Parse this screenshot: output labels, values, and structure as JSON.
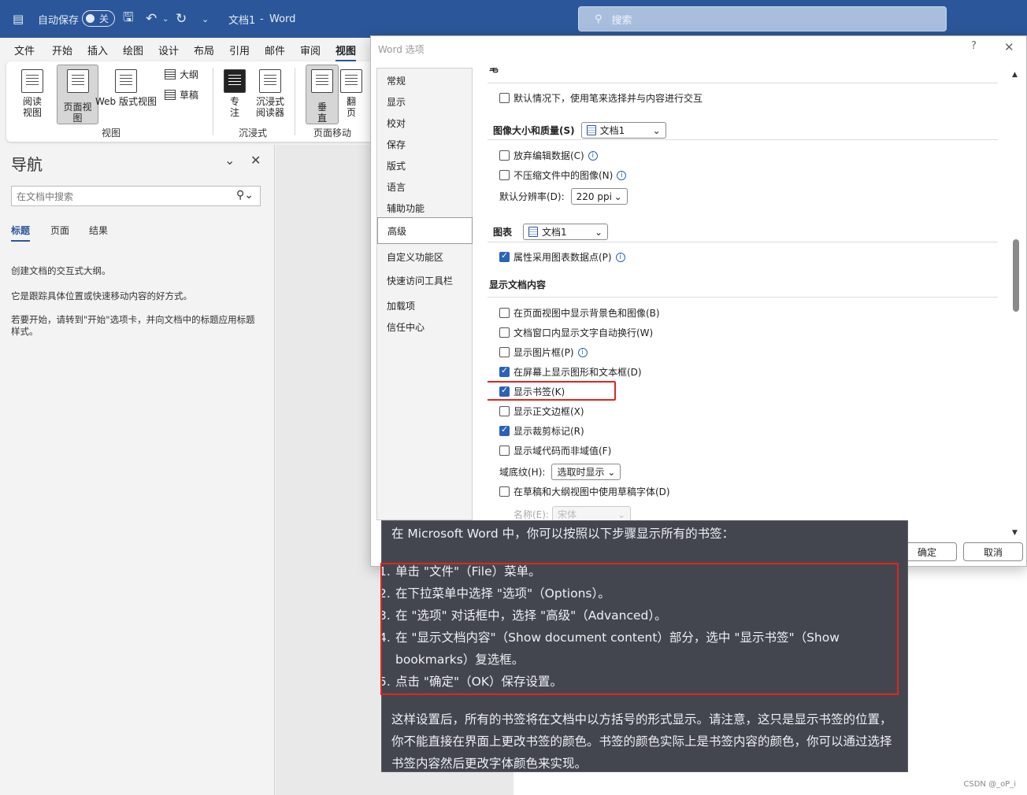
{
  "titlebar": {
    "autosave_label": "自动保存",
    "autosave_state": "关",
    "document_title": "文档1",
    "separator": "-",
    "app_name": "Word",
    "search_placeholder": "搜索"
  },
  "ribbon": {
    "tabs": [
      "文件",
      "开始",
      "插入",
      "绘图",
      "设计",
      "布局",
      "引用",
      "邮件",
      "审阅",
      "视图"
    ],
    "active_tab": "视图",
    "buttons": {
      "read_mode": "阅读视图",
      "print_layout": "页面视图",
      "web_layout": "Web 版式视图",
      "outline": "大纲",
      "draft": "草稿",
      "focus": "专注",
      "immersive_reader": "沉浸式阅读器",
      "vertical": "垂直",
      "side_to_side": "翻页"
    },
    "groups": {
      "views": "视图",
      "immersive": "沉浸式",
      "page_movement": "页面移动"
    }
  },
  "nav": {
    "title": "导航",
    "search_placeholder": "在文档中搜索",
    "tabs": [
      "标题",
      "页面",
      "结果"
    ],
    "active_tab": "标题",
    "text1": "创建文档的交互式大纲。",
    "text2": "它是跟踪具体位置或快速移动内容的好方式。",
    "text3": "若要开始，请转到\"开始\"选项卡，并向文档中的标题应用标题样式。"
  },
  "dialog": {
    "title": "Word 选项",
    "help": "?",
    "close": "✕",
    "categories": [
      "常规",
      "显示",
      "校对",
      "保存",
      "版式",
      "语言",
      "辅助功能",
      "高级",
      "自定义功能区",
      "快速访问工具栏",
      "加载项",
      "信任中心"
    ],
    "active_category": "高级",
    "pen_section_partial": "笔",
    "pen_option": "默认情况下，使用笔来选择并与内容进行交互",
    "image_section": "图像大小和质量(S)",
    "image_doc": "文档1",
    "image_options": [
      "放弃编辑数据(C)",
      "不压缩文件中的图像(N)"
    ],
    "resolution_label": "默认分辨率(D):",
    "resolution_value": "220 ppi",
    "chart_section": "图表",
    "chart_doc": "文档1",
    "chart_option": "属性采用图表数据点(P)",
    "show_section": "显示文档内容",
    "show_options": [
      {
        "label": "在页面视图中显示背景色和图像(B)",
        "checked": false
      },
      {
        "label": "文档窗口内显示文字自动换行(W)",
        "checked": false
      },
      {
        "label": "显示图片框(P)",
        "checked": false
      },
      {
        "label": "在屏幕上显示图形和文本框(D)",
        "checked": true
      },
      {
        "label": "显示书签(K)",
        "checked": true
      },
      {
        "label": "显示正文边框(X)",
        "checked": false
      },
      {
        "label": "显示裁剪标记(R)",
        "checked": true
      },
      {
        "label": "显示域代码而非域值(F)",
        "checked": false
      }
    ],
    "field_shading_label": "域底纹(H):",
    "field_shading_value": "选取时显示",
    "draft_font_option": "在草稿和大纲视图中使用草稿字体(D)",
    "font_name_label": "名称(E):",
    "font_name_value": "宋体",
    "ok": "确定",
    "cancel": "取消"
  },
  "chat": {
    "intro": "在 Microsoft Word 中，你可以按照以下步骤显示所有的书签：",
    "steps": [
      {
        "num": "1.",
        "text": "单击 \"文件\"（File）菜单。"
      },
      {
        "num": "2.",
        "text": "在下拉菜单中选择 \"选项\"（Options）。"
      },
      {
        "num": "3.",
        "text": "在 \"选项\" 对话框中，选择 \"高级\"（Advanced）。"
      },
      {
        "num": "4.",
        "text": "在 \"显示文档内容\"（Show document content）部分，选中 \"显示书签\"（Show bookmarks）复选框。"
      },
      {
        "num": "5.",
        "text": "点击 \"确定\"（OK）保存设置。"
      }
    ],
    "outro": "这样设置后，所有的书签将在文档中以方括号的形式显示。请注意，这只是显示书签的位置，你不能直接在界面上更改书签的颜色。书签的颜色实际上是书签内容的颜色，你可以通过选择书签内容然后更改字体颜色来实现。"
  },
  "watermark": "CSDN @_oP_i",
  "colors": {
    "titlebar": "#2b579a",
    "highlight": "#e0261f",
    "chat_bg": "#44464f",
    "checkbox_on": "#2b62b8"
  }
}
